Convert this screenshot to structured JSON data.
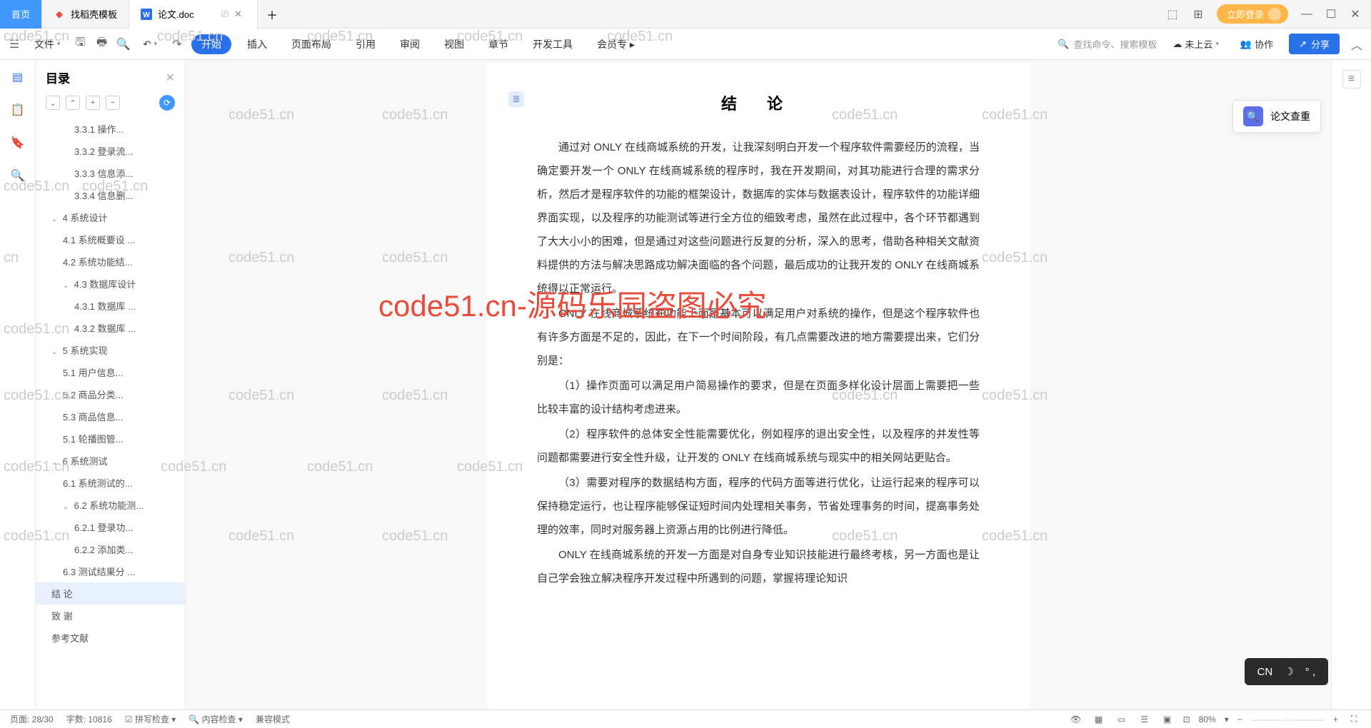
{
  "tabs": {
    "home": "首页",
    "template": "找稻壳模板",
    "doc": "论文.doc"
  },
  "login": "立即登录",
  "file_menu": "文件",
  "ribbon": [
    "开始",
    "插入",
    "页面布局",
    "引用",
    "审阅",
    "视图",
    "章节",
    "开发工具",
    "会员专"
  ],
  "search_placeholder": "查找命令、搜索模板",
  "cloud": "未上云",
  "collab": "协作",
  "share": "分享",
  "outline": {
    "title": "目录",
    "items": [
      {
        "text": "3.3.1 操作...",
        "indent": 3
      },
      {
        "text": "3.3.2 登录流...",
        "indent": 3
      },
      {
        "text": "3.3.3 信息添...",
        "indent": 3
      },
      {
        "text": "3.3.4 信息删...",
        "indent": 3
      },
      {
        "text": "4 系统设计",
        "indent": 1,
        "chev": "v"
      },
      {
        "text": "4.1 系统概要设 ...",
        "indent": 2
      },
      {
        "text": "4.2 系统功能结...",
        "indent": 2
      },
      {
        "text": "4.3 数据库设计",
        "indent": 2,
        "chev": "v"
      },
      {
        "text": "4.3.1 数据库 ...",
        "indent": 3
      },
      {
        "text": "4.3.2 数据库 ...",
        "indent": 3
      },
      {
        "text": "5 系统实现",
        "indent": 1,
        "chev": "v"
      },
      {
        "text": "5.1 用户信息...",
        "indent": 2
      },
      {
        "text": "5.2 商品分类...",
        "indent": 2
      },
      {
        "text": "5.3 商品信息...",
        "indent": 2
      },
      {
        "text": "5.1 轮播图管...",
        "indent": 2
      },
      {
        "text": "6 系统测试",
        "indent": 1,
        "chev": "v"
      },
      {
        "text": "6.1 系统测试的...",
        "indent": 2
      },
      {
        "text": "6.2 系统功能测...",
        "indent": 2,
        "chev": "v"
      },
      {
        "text": "6.2.1 登录功...",
        "indent": 3
      },
      {
        "text": "6.2.2 添加类...",
        "indent": 3
      },
      {
        "text": "6.3 测试结果分 ...",
        "indent": 2
      },
      {
        "text": "结  论",
        "indent": 1,
        "active": true
      },
      {
        "text": "致  谢",
        "indent": 1
      },
      {
        "text": "参考文献",
        "indent": 1
      }
    ]
  },
  "doc": {
    "title": "结  论",
    "p1": "通过对 ONLY 在线商城系统的开发，让我深刻明白开发一个程序软件需要经历的流程，当确定要开发一个 ONLY 在线商城系统的程序时，我在开发期间，对其功能进行合理的需求分析，然后才是程序软件的功能的框架设计，数据库的实体与数据表设计，程序软件的功能详细界面实现，以及程序的功能测试等进行全方位的细致考虑，虽然在此过程中，各个环节都遇到了大大小小的困难，但是通过对这些问题进行反复的分析，深入的思考，借助各种相关文献资料提供的方法与解决思路成功解决面临的各个问题，最后成功的让我开发的 ONLY 在线商城系统得以正常运行。",
    "p2": "ONLY 在线商城系统在功能上面是基本可以满足用户对系统的操作，但是这个程序软件也有许多方面是不足的，因此，在下一个时间阶段，有几点需要改进的地方需要提出来，它们分别是：",
    "p3": "（1）操作页面可以满足用户简易操作的要求，但是在页面多样化设计层面上需要把一些比较丰富的设计结构考虑进来。",
    "p4": "（2）程序软件的总体安全性能需要优化，例如程序的退出安全性，以及程序的并发性等问题都需要进行安全性升级，让开发的 ONLY 在线商城系统与现实中的相关网站更贴合。",
    "p5": "（3）需要对程序的数据结构方面，程序的代码方面等进行优化，让运行起来的程序可以保持稳定运行，也让程序能够保证短时间内处理相关事务，节省处理事务的时间，提高事务处理的效率，同时对服务器上资源占用的比例进行降低。",
    "p6": "ONLY 在线商城系统的开发一方面是对自身专业知识技能进行最终考核，另一方面也是让自己学会独立解决程序开发过程中所遇到的问题，掌握将理论知识"
  },
  "float_panel": "论文查重",
  "status": {
    "page": "页面: 28/30",
    "words": "字数: 10816",
    "spell": "拼写检查",
    "content": "内容检查",
    "compat": "兼容模式",
    "zoom": "80%"
  },
  "wm_red": "code51.cn-源码乐园盗图必究",
  "ime": "CN"
}
